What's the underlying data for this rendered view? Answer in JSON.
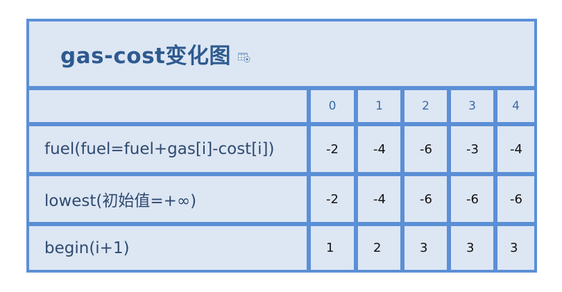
{
  "title": "gas-cost变化图",
  "title_icon": "table-add-icon",
  "columns": [
    "0",
    "1",
    "2",
    "3",
    "4"
  ],
  "rows": [
    {
      "label": "fuel(fuel=fuel+gas[i]-cost[i])",
      "values": [
        "-2",
        "-4",
        "-6",
        "-3",
        "-4"
      ]
    },
    {
      "label": "lowest(初始值=+∞)",
      "values": [
        "-2",
        "-4",
        "-6",
        "-6",
        "-6"
      ]
    },
    {
      "label": "begin(i+1)",
      "values": [
        "1",
        "2",
        "3",
        "3",
        "3"
      ]
    }
  ],
  "colors": {
    "border": "#5b8fd6",
    "cell_bg": "#dde6f3",
    "title": "#2e5a8f",
    "header_text": "#3d6aa6"
  }
}
